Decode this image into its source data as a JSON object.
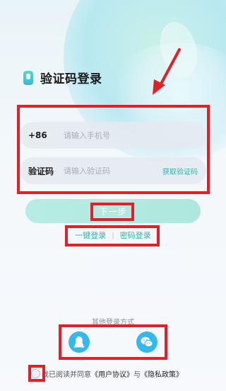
{
  "header": {
    "title": "验证码登录",
    "icon": "phone-app-icon"
  },
  "form": {
    "phone": {
      "prefix": "+86",
      "placeholder": "请输入手机号",
      "value": ""
    },
    "code": {
      "label": "验证码",
      "placeholder": "请输入验证码",
      "value": "",
      "get_code_label": "获取验证码"
    },
    "next_label": "下一步"
  },
  "alt_login": {
    "one_click_label": "一键登录",
    "separator": "|",
    "password_label": "密码登录"
  },
  "other_login": {
    "title": "其他登录方式",
    "providers": [
      "qq-icon",
      "wechat-icon"
    ]
  },
  "agreement": {
    "prefix": "我已阅读并同意",
    "user_agreement": "《用户协议》",
    "and": "与",
    "privacy_policy": "《隐私政策》",
    "checked": false
  },
  "colors": {
    "accent": "#2fb5a8",
    "button": "#b2e9e0",
    "social": "#35b8ec",
    "highlight": "#e2202a"
  }
}
